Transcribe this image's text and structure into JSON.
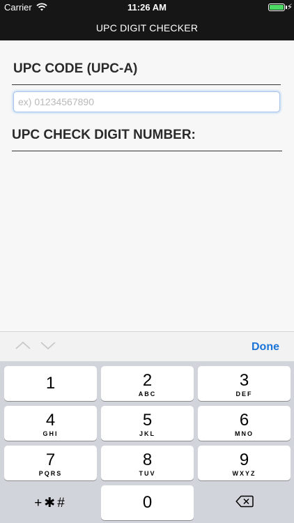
{
  "status_bar": {
    "carrier": "Carrier",
    "time": "11:26 AM"
  },
  "nav": {
    "title": "UPC DIGIT CHECKER"
  },
  "form": {
    "upc_label": "UPC CODE (UPC-A)",
    "upc_placeholder": "ex) 01234567890",
    "upc_value": "",
    "check_digit_label": "UPC CHECK DIGIT NUMBER:"
  },
  "accessory": {
    "done_label": "Done",
    "icons": [
      "chevron-up-icon",
      "chevron-down-icon"
    ]
  },
  "keyboard": {
    "keys": [
      {
        "num": "1",
        "letters": ""
      },
      {
        "num": "2",
        "letters": "ABC"
      },
      {
        "num": "3",
        "letters": "DEF"
      },
      {
        "num": "4",
        "letters": "GHI"
      },
      {
        "num": "5",
        "letters": "JKL"
      },
      {
        "num": "6",
        "letters": "MNO"
      },
      {
        "num": "7",
        "letters": "PQRS"
      },
      {
        "num": "8",
        "letters": "TUV"
      },
      {
        "num": "9",
        "letters": "WXYZ"
      },
      {
        "num": "0",
        "letters": ""
      }
    ],
    "symbols_label": "+✱#",
    "delete_icon": "backspace-icon"
  },
  "colors": {
    "accent": "#1b74d6",
    "bar": "#161616",
    "battery": "#4cd964"
  }
}
